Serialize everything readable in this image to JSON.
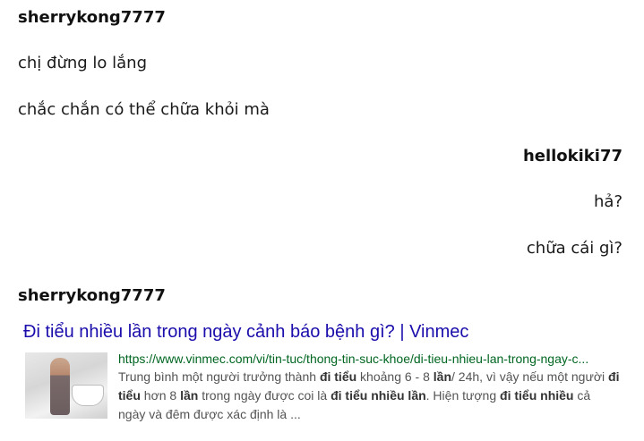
{
  "messages": [
    {
      "user": "sherrykong7777",
      "lines": [
        "chị đừng lo lắng",
        "chắc chắn có thể chữa khỏi mà"
      ]
    },
    {
      "user": "hellokiki77",
      "lines": [
        "hả?",
        "chữa cái gì?"
      ]
    },
    {
      "user": "sherrykong7777"
    }
  ],
  "search_result": {
    "title": "Đi tiểu nhiều lần trong ngày cảnh báo bệnh gì? | Vinmec",
    "url": "https://www.vinmec.com/vi/tin-tuc/thong-tin-suc-khoe/di-tieu-nhieu-lan-trong-ngay-c...",
    "snippet": {
      "s1": "Trung bình một người trưởng thành ",
      "b1": "đi tiểu",
      "s2": " khoảng 6 - 8 ",
      "b2": "lần",
      "s3": "/ 24h, vì vậy nếu một người ",
      "b3": "đi tiểu",
      "s4": " hơn 8 ",
      "b4": "lần",
      "s5": " trong ngày được coi là ",
      "b5": "đi tiểu nhiều lần",
      "s6": ". Hiện tượng ",
      "b6": "đi tiểu nhiều",
      "s7": " cả ngày và đêm được xác định là ..."
    }
  }
}
